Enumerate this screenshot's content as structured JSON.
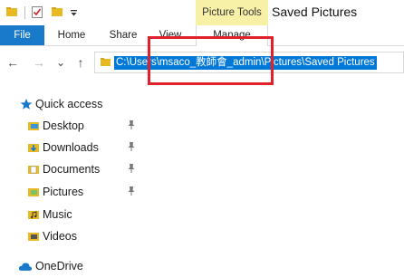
{
  "window": {
    "title": "Saved Pictures",
    "context_group": "Picture Tools"
  },
  "ribbon": {
    "tabs": [
      {
        "label": "File",
        "active": true
      },
      {
        "label": "Home"
      },
      {
        "label": "Share"
      },
      {
        "label": "View"
      },
      {
        "label": "Manage"
      }
    ]
  },
  "quick_access_toolbar": {
    "icons": [
      "folder-icon",
      "properties-checkmark-icon",
      "new-folder-icon",
      "customize-dropdown-icon"
    ]
  },
  "navigation": {
    "back": "←",
    "forward": "→",
    "recent": "⌄",
    "up": "↑"
  },
  "address_bar": {
    "path": "C:\\Users\\msaco_教師會_admin\\Pictures\\Saved Pictures",
    "selected": true
  },
  "nav_pane": {
    "quick_access_label": "Quick access",
    "items": [
      {
        "label": "Desktop",
        "icon": "desktop-folder-icon",
        "pinned": true
      },
      {
        "label": "Downloads",
        "icon": "downloads-icon",
        "pinned": true
      },
      {
        "label": "Documents",
        "icon": "documents-icon",
        "pinned": true
      },
      {
        "label": "Pictures",
        "icon": "pictures-icon",
        "pinned": true
      },
      {
        "label": "Music",
        "icon": "music-icon",
        "pinned": false
      },
      {
        "label": "Videos",
        "icon": "videos-icon",
        "pinned": false
      }
    ],
    "onedrive_label": "OneDrive"
  },
  "colors": {
    "file_tab": "#1979ca",
    "context_tab": "#f7f1a8",
    "selection": "#0078d7",
    "annotation": "#e0202a"
  }
}
